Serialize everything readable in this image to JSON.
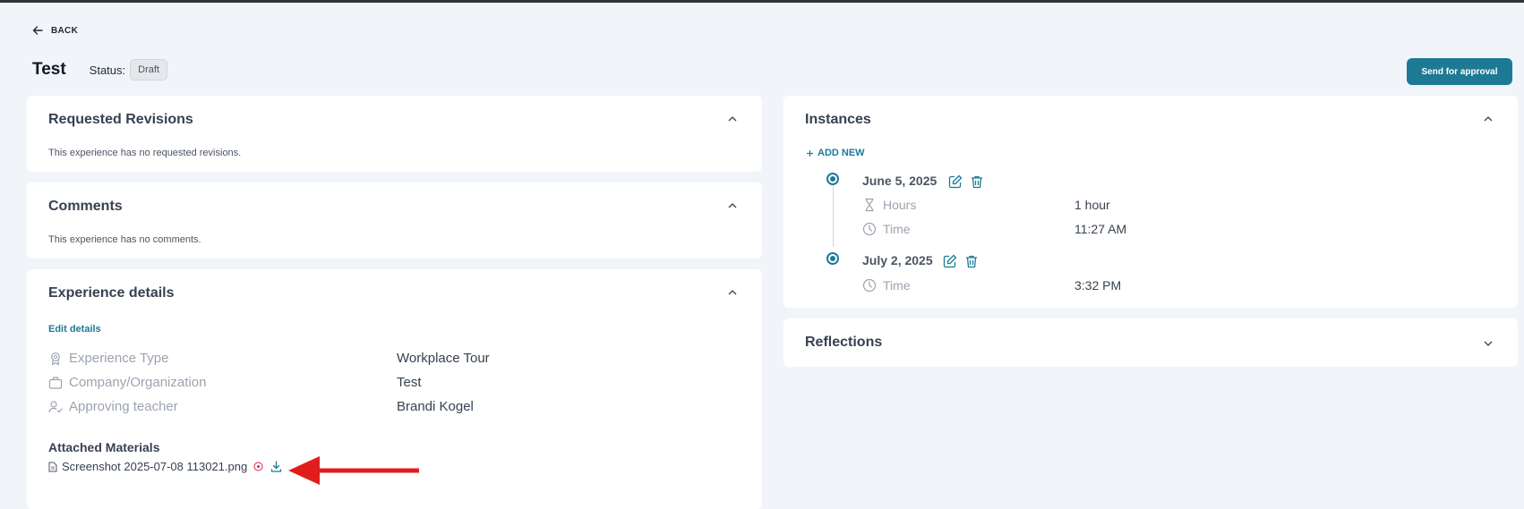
{
  "header": {
    "back_label": "BACK",
    "title": "Test",
    "status_label": "Status:",
    "status_value": "Draft",
    "send_button": "Send for approval"
  },
  "revisions": {
    "title": "Requested Revisions",
    "empty_text": "This experience has no requested revisions."
  },
  "comments": {
    "title": "Comments",
    "empty_text": "This experience has no comments."
  },
  "details": {
    "title": "Experience details",
    "edit_link": "Edit details",
    "rows": [
      {
        "label": "Experience Type",
        "value": "Workplace Tour",
        "icon": "badge-icon"
      },
      {
        "label": "Company/Organization",
        "value": "Test",
        "icon": "briefcase-icon"
      },
      {
        "label": "Approving teacher",
        "value": "Brandi Kogel",
        "icon": "user-check-icon"
      }
    ],
    "attached_title": "Attached Materials",
    "file_name": "Screenshot 2025-07-08 113021.png"
  },
  "instances": {
    "title": "Instances",
    "add_new": "ADD NEW",
    "items": [
      {
        "date": "June 5, 2025",
        "rows": [
          {
            "label": "Hours",
            "value": "1 hour",
            "icon": "hourglass-icon"
          },
          {
            "label": "Time",
            "value": "11:27 AM",
            "icon": "clock-icon"
          }
        ]
      },
      {
        "date": "July 2, 2025",
        "rows": [
          {
            "label": "Time",
            "value": "3:32 PM",
            "icon": "clock-icon"
          }
        ]
      }
    ]
  },
  "reflections": {
    "title": "Reflections"
  },
  "colors": {
    "accent": "#1d7a95",
    "page_background": "#f1f5f9",
    "annotation_arrow": "#e11d1d"
  }
}
